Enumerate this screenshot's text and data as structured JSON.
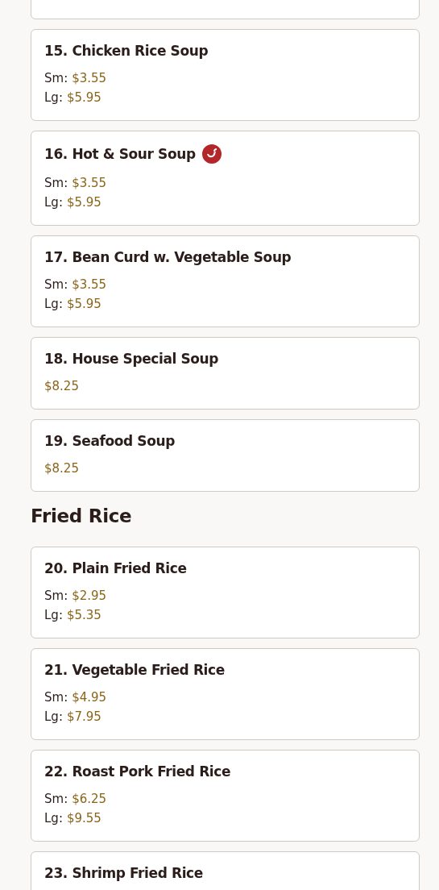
{
  "sections": [
    {
      "items": [
        {
          "name": "15. Chicken Rice Soup",
          "spicy": false,
          "prices": [
            {
              "size": "Sm:",
              "price": "$3.55"
            },
            {
              "size": "Lg:",
              "price": "$5.95"
            }
          ]
        },
        {
          "name": "16. Hot & Sour Soup",
          "spicy": true,
          "prices": [
            {
              "size": "Sm:",
              "price": "$3.55"
            },
            {
              "size": "Lg:",
              "price": "$5.95"
            }
          ]
        },
        {
          "name": "17. Bean Curd w. Vegetable Soup",
          "spicy": false,
          "prices": [
            {
              "size": "Sm:",
              "price": "$3.55"
            },
            {
              "size": "Lg:",
              "price": "$5.95"
            }
          ]
        },
        {
          "name": "18. House Special Soup",
          "spicy": false,
          "prices": [
            {
              "price": "$8.25"
            }
          ]
        },
        {
          "name": "19. Seafood Soup",
          "spicy": false,
          "prices": [
            {
              "price": "$8.25"
            }
          ]
        }
      ]
    },
    {
      "heading": "Fried Rice",
      "items": [
        {
          "name": "20. Plain Fried Rice",
          "spicy": false,
          "prices": [
            {
              "size": "Sm:",
              "price": "$2.95"
            },
            {
              "size": "Lg:",
              "price": "$5.35"
            }
          ]
        },
        {
          "name": "21. Vegetable Fried Rice",
          "spicy": false,
          "prices": [
            {
              "size": "Sm:",
              "price": "$4.95"
            },
            {
              "size": "Lg:",
              "price": "$7.95"
            }
          ]
        },
        {
          "name": "22. Roast Pork Fried Rice",
          "spicy": false,
          "prices": [
            {
              "size": "Sm:",
              "price": "$6.25"
            },
            {
              "size": "Lg:",
              "price": "$9.55"
            }
          ]
        },
        {
          "name": "23. Shrimp Fried Rice",
          "spicy": false
        }
      ]
    }
  ]
}
